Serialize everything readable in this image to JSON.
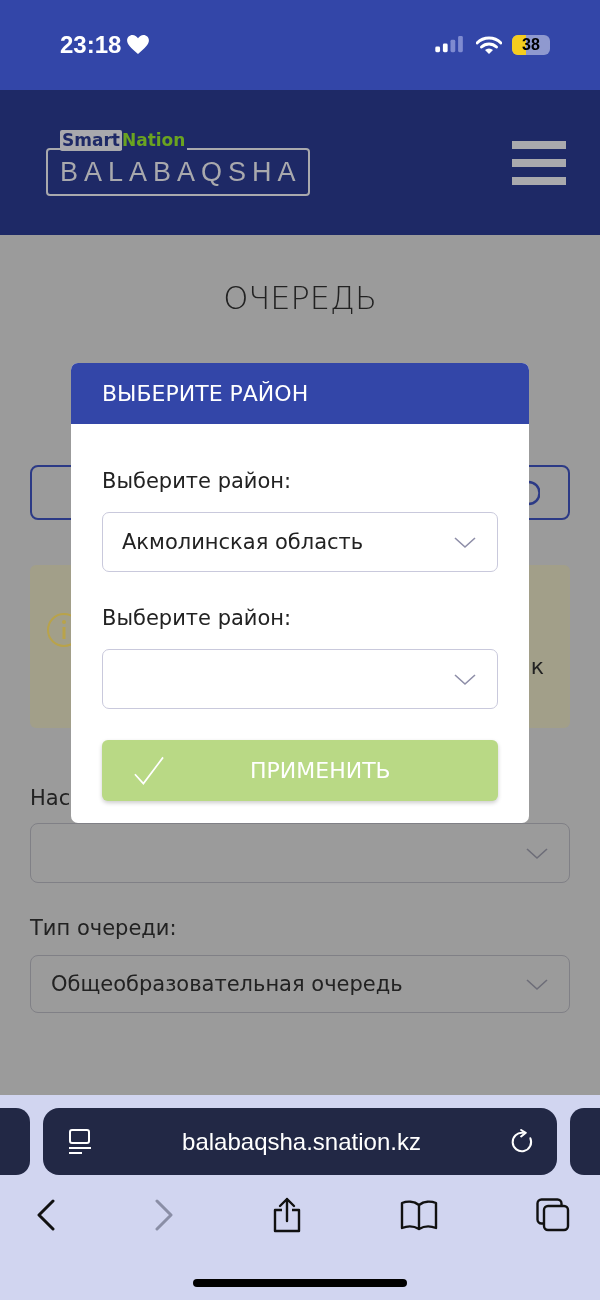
{
  "status_bar": {
    "time": "23:18",
    "battery": "38"
  },
  "header": {
    "logo_top_left": "Smart",
    "logo_top_right": "Nation",
    "logo_main": "BALABAQSHA"
  },
  "page": {
    "title": "ОЧЕРЕДЬ",
    "notice_fragment": "к",
    "fields": [
      {
        "label": "Нас"
      },
      {
        "label": "Тип очереди:",
        "value": "Общеобразовательная очередь"
      }
    ]
  },
  "modal": {
    "title": "ВЫБЕРИТЕ РАЙОН",
    "fields": [
      {
        "label": "Выберите район:",
        "value": "Акмолинская область"
      },
      {
        "label": "Выберите район:"
      }
    ],
    "apply_button": {
      "label": "ПРИМЕНИТЬ",
      "disabled": true
    }
  },
  "browser": {
    "url": "balabaqsha.snation.kz",
    "toolbar": [
      {
        "kind": "back",
        "disabled": false
      },
      {
        "kind": "forward",
        "disabled": true
      },
      {
        "kind": "share",
        "disabled": false
      },
      {
        "kind": "bookmarks",
        "disabled": false
      },
      {
        "kind": "tabs",
        "disabled": false
      }
    ]
  }
}
